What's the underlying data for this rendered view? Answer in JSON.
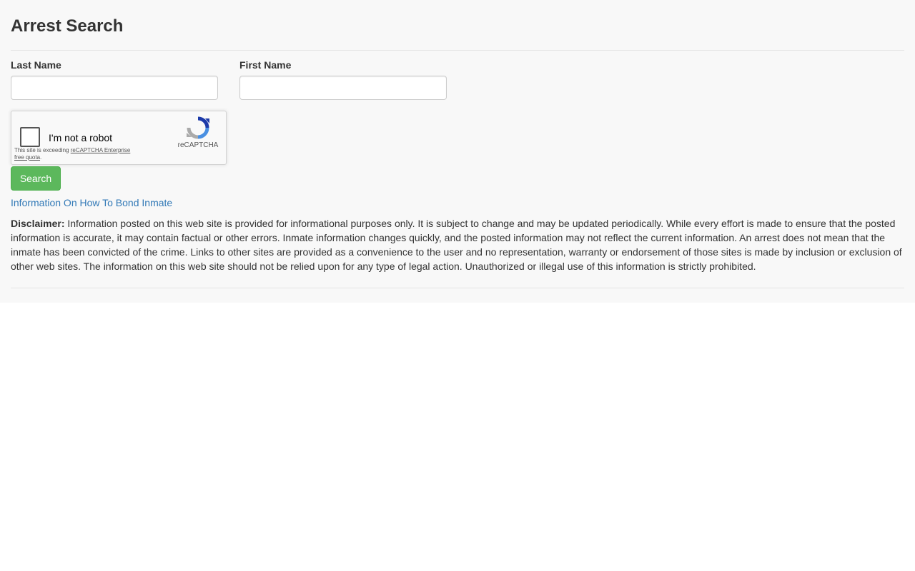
{
  "page": {
    "title": "Arrest Search"
  },
  "form": {
    "last_name_label": "Last Name",
    "last_name_value": "",
    "first_name_label": "First Name",
    "first_name_value": ""
  },
  "captcha": {
    "label": "I'm not a robot",
    "note_prefix": "This site is exceeding ",
    "note_link": "reCAPTCHA Enterprise free quota",
    "note_suffix": ".",
    "brand": "reCAPTCHA",
    "checked": false
  },
  "actions": {
    "search_label": "Search",
    "bond_link": "Information On How To Bond Inmate"
  },
  "disclaimer": {
    "heading": "Disclaimer:",
    "body": " Information posted on this web site is provided for informational purposes only. It is subject to change and may be updated periodically. While every effort is made to ensure that the posted information is accurate, it may contain factual or other errors. Inmate information changes quickly, and the posted information may not reflect the current information. An arrest does not mean that the inmate has been convicted of the crime. Links to other sites are provided as a convenience to the user and no representation, warranty or endorsement of those sites is made by inclusion or exclusion of other web sites. The information on this web site should not be relied upon for any type of legal action. Unauthorized or illegal use of this information is strictly prohibited."
  },
  "colors": {
    "panel_background": "#f8f8f8",
    "search_button": "#5cb85c",
    "link": "#337ab7",
    "captcha_logo_blue": "#1c3aa9",
    "captcha_logo_grey": "#aaaaaa"
  }
}
